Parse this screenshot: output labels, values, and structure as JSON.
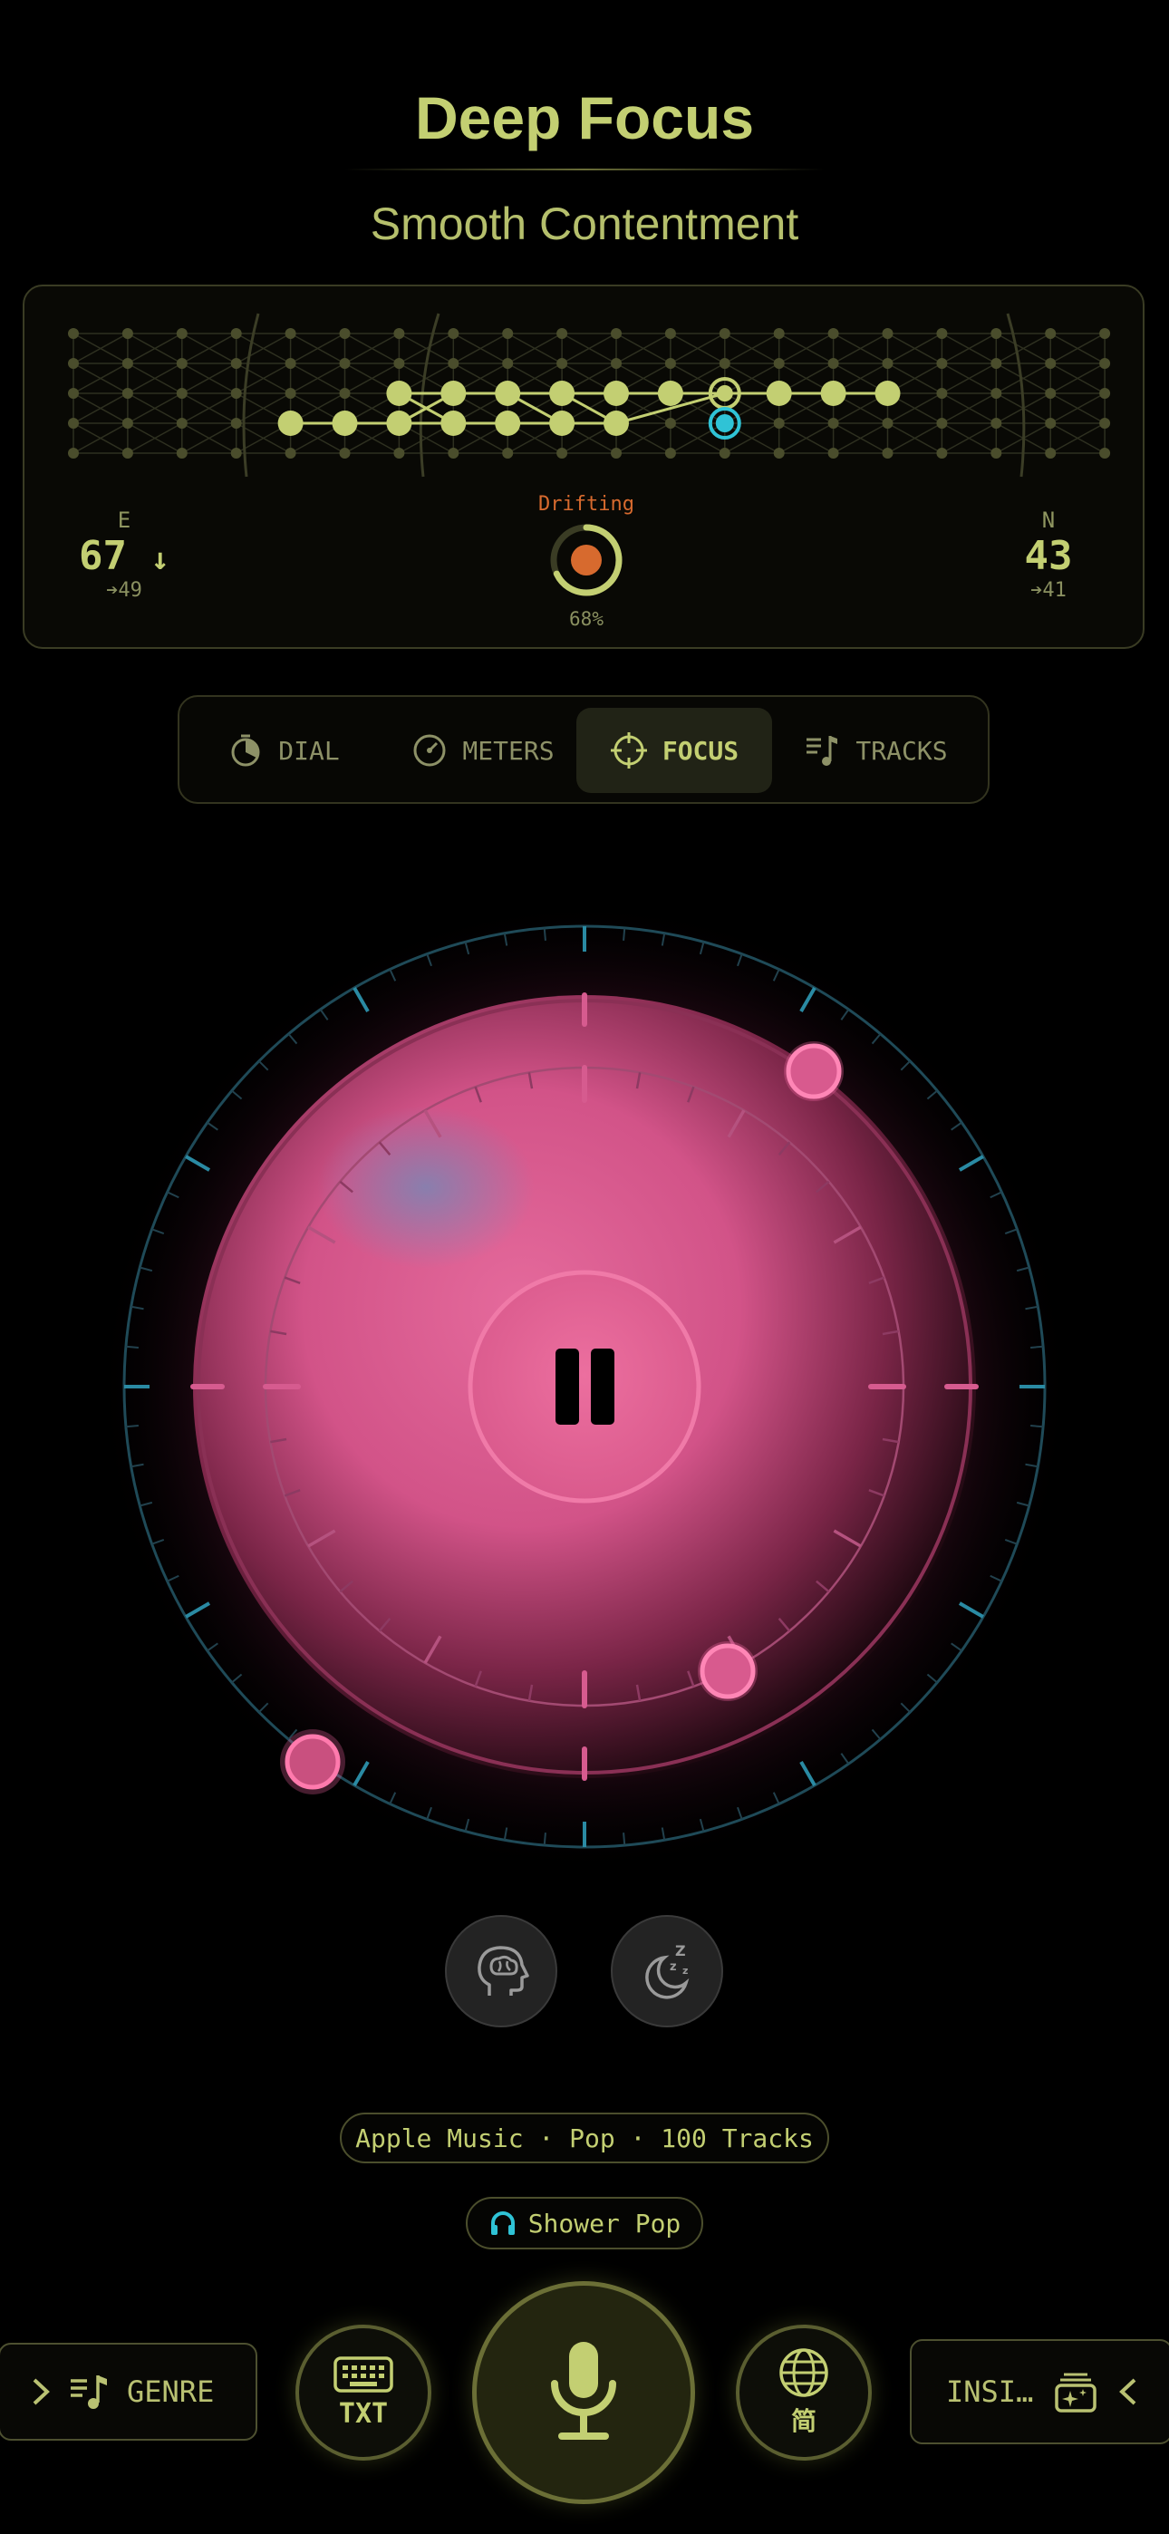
{
  "header": {
    "title": "Deep Focus",
    "subtitle": "Smooth Contentment"
  },
  "mood_panel": {
    "left_stat": {
      "label": "E",
      "value": "67",
      "arrow": "↓",
      "target": "➔49"
    },
    "center": {
      "status": "Drifting",
      "percent": "68%",
      "progress": 0.68
    },
    "right_stat": {
      "label": "N",
      "value": "43",
      "target": "➔41"
    }
  },
  "tabs": [
    {
      "label": "DIAL",
      "icon": "timer-icon",
      "active": false
    },
    {
      "label": "METERS",
      "icon": "gauge-icon",
      "active": false
    },
    {
      "label": "FOCUS",
      "icon": "crosshair-icon",
      "active": true
    },
    {
      "label": "TRACKS",
      "icon": "music-list-icon",
      "active": false
    }
  ],
  "dial": {
    "play_state": "paused",
    "control_icon": "pause-icon"
  },
  "mode_buttons": [
    {
      "name": "brain-head-icon"
    },
    {
      "name": "sleep-moon-icon",
      "text": "Z z z"
    }
  ],
  "source": {
    "label": "Apple Music · Pop · 100 Tracks"
  },
  "station": {
    "label": "Shower Pop",
    "icon": "headphones-icon"
  },
  "bottom_bar": {
    "genre_label": "GENRE",
    "text_button_label": "TXT",
    "language_label": "简",
    "insights_label": "INSI…"
  },
  "colors": {
    "accent": "#c3cf72",
    "drift": "#d76a2e",
    "cyan": "#2fc3d6",
    "pink": "#e85a92"
  }
}
